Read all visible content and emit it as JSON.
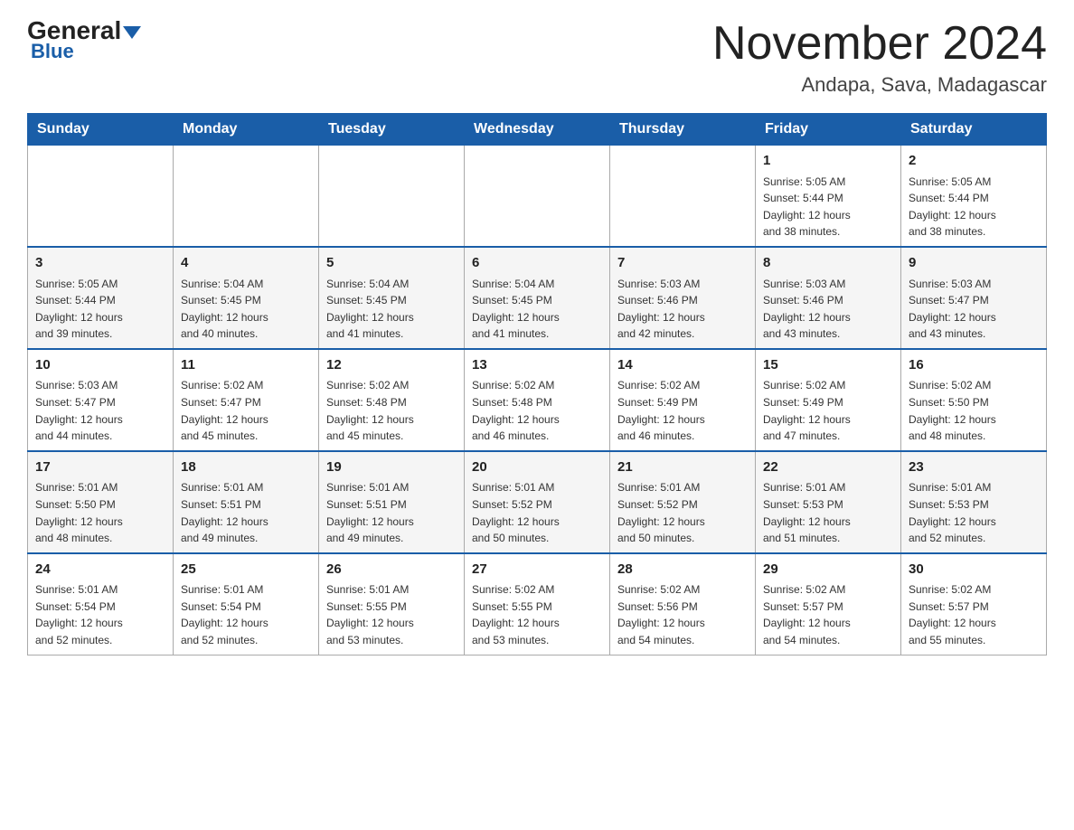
{
  "header": {
    "logo_general": "General",
    "logo_blue": "Blue",
    "title": "November 2024",
    "subtitle": "Andapa, Sava, Madagascar"
  },
  "days_of_week": [
    "Sunday",
    "Monday",
    "Tuesday",
    "Wednesday",
    "Thursday",
    "Friday",
    "Saturday"
  ],
  "weeks": [
    [
      {
        "day": "",
        "info": ""
      },
      {
        "day": "",
        "info": ""
      },
      {
        "day": "",
        "info": ""
      },
      {
        "day": "",
        "info": ""
      },
      {
        "day": "",
        "info": ""
      },
      {
        "day": "1",
        "info": "Sunrise: 5:05 AM\nSunset: 5:44 PM\nDaylight: 12 hours\nand 38 minutes."
      },
      {
        "day": "2",
        "info": "Sunrise: 5:05 AM\nSunset: 5:44 PM\nDaylight: 12 hours\nand 38 minutes."
      }
    ],
    [
      {
        "day": "3",
        "info": "Sunrise: 5:05 AM\nSunset: 5:44 PM\nDaylight: 12 hours\nand 39 minutes."
      },
      {
        "day": "4",
        "info": "Sunrise: 5:04 AM\nSunset: 5:45 PM\nDaylight: 12 hours\nand 40 minutes."
      },
      {
        "day": "5",
        "info": "Sunrise: 5:04 AM\nSunset: 5:45 PM\nDaylight: 12 hours\nand 41 minutes."
      },
      {
        "day": "6",
        "info": "Sunrise: 5:04 AM\nSunset: 5:45 PM\nDaylight: 12 hours\nand 41 minutes."
      },
      {
        "day": "7",
        "info": "Sunrise: 5:03 AM\nSunset: 5:46 PM\nDaylight: 12 hours\nand 42 minutes."
      },
      {
        "day": "8",
        "info": "Sunrise: 5:03 AM\nSunset: 5:46 PM\nDaylight: 12 hours\nand 43 minutes."
      },
      {
        "day": "9",
        "info": "Sunrise: 5:03 AM\nSunset: 5:47 PM\nDaylight: 12 hours\nand 43 minutes."
      }
    ],
    [
      {
        "day": "10",
        "info": "Sunrise: 5:03 AM\nSunset: 5:47 PM\nDaylight: 12 hours\nand 44 minutes."
      },
      {
        "day": "11",
        "info": "Sunrise: 5:02 AM\nSunset: 5:47 PM\nDaylight: 12 hours\nand 45 minutes."
      },
      {
        "day": "12",
        "info": "Sunrise: 5:02 AM\nSunset: 5:48 PM\nDaylight: 12 hours\nand 45 minutes."
      },
      {
        "day": "13",
        "info": "Sunrise: 5:02 AM\nSunset: 5:48 PM\nDaylight: 12 hours\nand 46 minutes."
      },
      {
        "day": "14",
        "info": "Sunrise: 5:02 AM\nSunset: 5:49 PM\nDaylight: 12 hours\nand 46 minutes."
      },
      {
        "day": "15",
        "info": "Sunrise: 5:02 AM\nSunset: 5:49 PM\nDaylight: 12 hours\nand 47 minutes."
      },
      {
        "day": "16",
        "info": "Sunrise: 5:02 AM\nSunset: 5:50 PM\nDaylight: 12 hours\nand 48 minutes."
      }
    ],
    [
      {
        "day": "17",
        "info": "Sunrise: 5:01 AM\nSunset: 5:50 PM\nDaylight: 12 hours\nand 48 minutes."
      },
      {
        "day": "18",
        "info": "Sunrise: 5:01 AM\nSunset: 5:51 PM\nDaylight: 12 hours\nand 49 minutes."
      },
      {
        "day": "19",
        "info": "Sunrise: 5:01 AM\nSunset: 5:51 PM\nDaylight: 12 hours\nand 49 minutes."
      },
      {
        "day": "20",
        "info": "Sunrise: 5:01 AM\nSunset: 5:52 PM\nDaylight: 12 hours\nand 50 minutes."
      },
      {
        "day": "21",
        "info": "Sunrise: 5:01 AM\nSunset: 5:52 PM\nDaylight: 12 hours\nand 50 minutes."
      },
      {
        "day": "22",
        "info": "Sunrise: 5:01 AM\nSunset: 5:53 PM\nDaylight: 12 hours\nand 51 minutes."
      },
      {
        "day": "23",
        "info": "Sunrise: 5:01 AM\nSunset: 5:53 PM\nDaylight: 12 hours\nand 52 minutes."
      }
    ],
    [
      {
        "day": "24",
        "info": "Sunrise: 5:01 AM\nSunset: 5:54 PM\nDaylight: 12 hours\nand 52 minutes."
      },
      {
        "day": "25",
        "info": "Sunrise: 5:01 AM\nSunset: 5:54 PM\nDaylight: 12 hours\nand 52 minutes."
      },
      {
        "day": "26",
        "info": "Sunrise: 5:01 AM\nSunset: 5:55 PM\nDaylight: 12 hours\nand 53 minutes."
      },
      {
        "day": "27",
        "info": "Sunrise: 5:02 AM\nSunset: 5:55 PM\nDaylight: 12 hours\nand 53 minutes."
      },
      {
        "day": "28",
        "info": "Sunrise: 5:02 AM\nSunset: 5:56 PM\nDaylight: 12 hours\nand 54 minutes."
      },
      {
        "day": "29",
        "info": "Sunrise: 5:02 AM\nSunset: 5:57 PM\nDaylight: 12 hours\nand 54 minutes."
      },
      {
        "day": "30",
        "info": "Sunrise: 5:02 AM\nSunset: 5:57 PM\nDaylight: 12 hours\nand 55 minutes."
      }
    ]
  ]
}
